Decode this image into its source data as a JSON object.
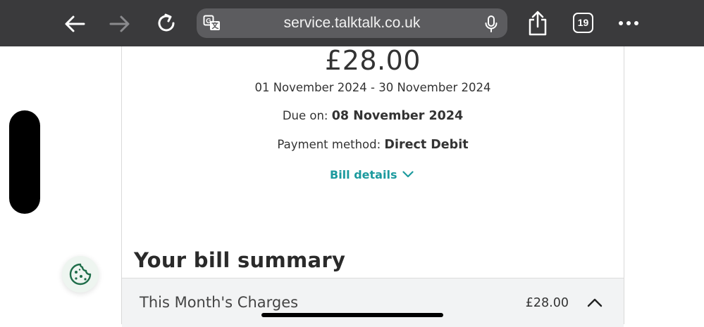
{
  "browser": {
    "url": "service.talktalk.co.uk",
    "tab_count": "19",
    "icons": {
      "back": "arrow-left-icon",
      "forward": "arrow-right-icon",
      "reload": "reload-icon",
      "translate": "translate-icon",
      "mic": "microphone-icon",
      "share": "share-icon",
      "more": "more-dots-icon"
    }
  },
  "bill": {
    "amount": "£28.00",
    "period": "01 November 2024 - 30 November 2024",
    "due_label": "Due on:",
    "due_date": "08 November 2024",
    "payment_label": "Payment method:",
    "payment_method": "Direct Debit",
    "details_link": "Bill details"
  },
  "summary": {
    "title": "Your bill summary",
    "rows": [
      {
        "label": "This Month's Charges",
        "amount": "£28.00"
      }
    ]
  },
  "colors": {
    "accent": "#1c9a9e",
    "topbar": "#3a3a3c",
    "cookie_icon": "#1f6e4a"
  }
}
